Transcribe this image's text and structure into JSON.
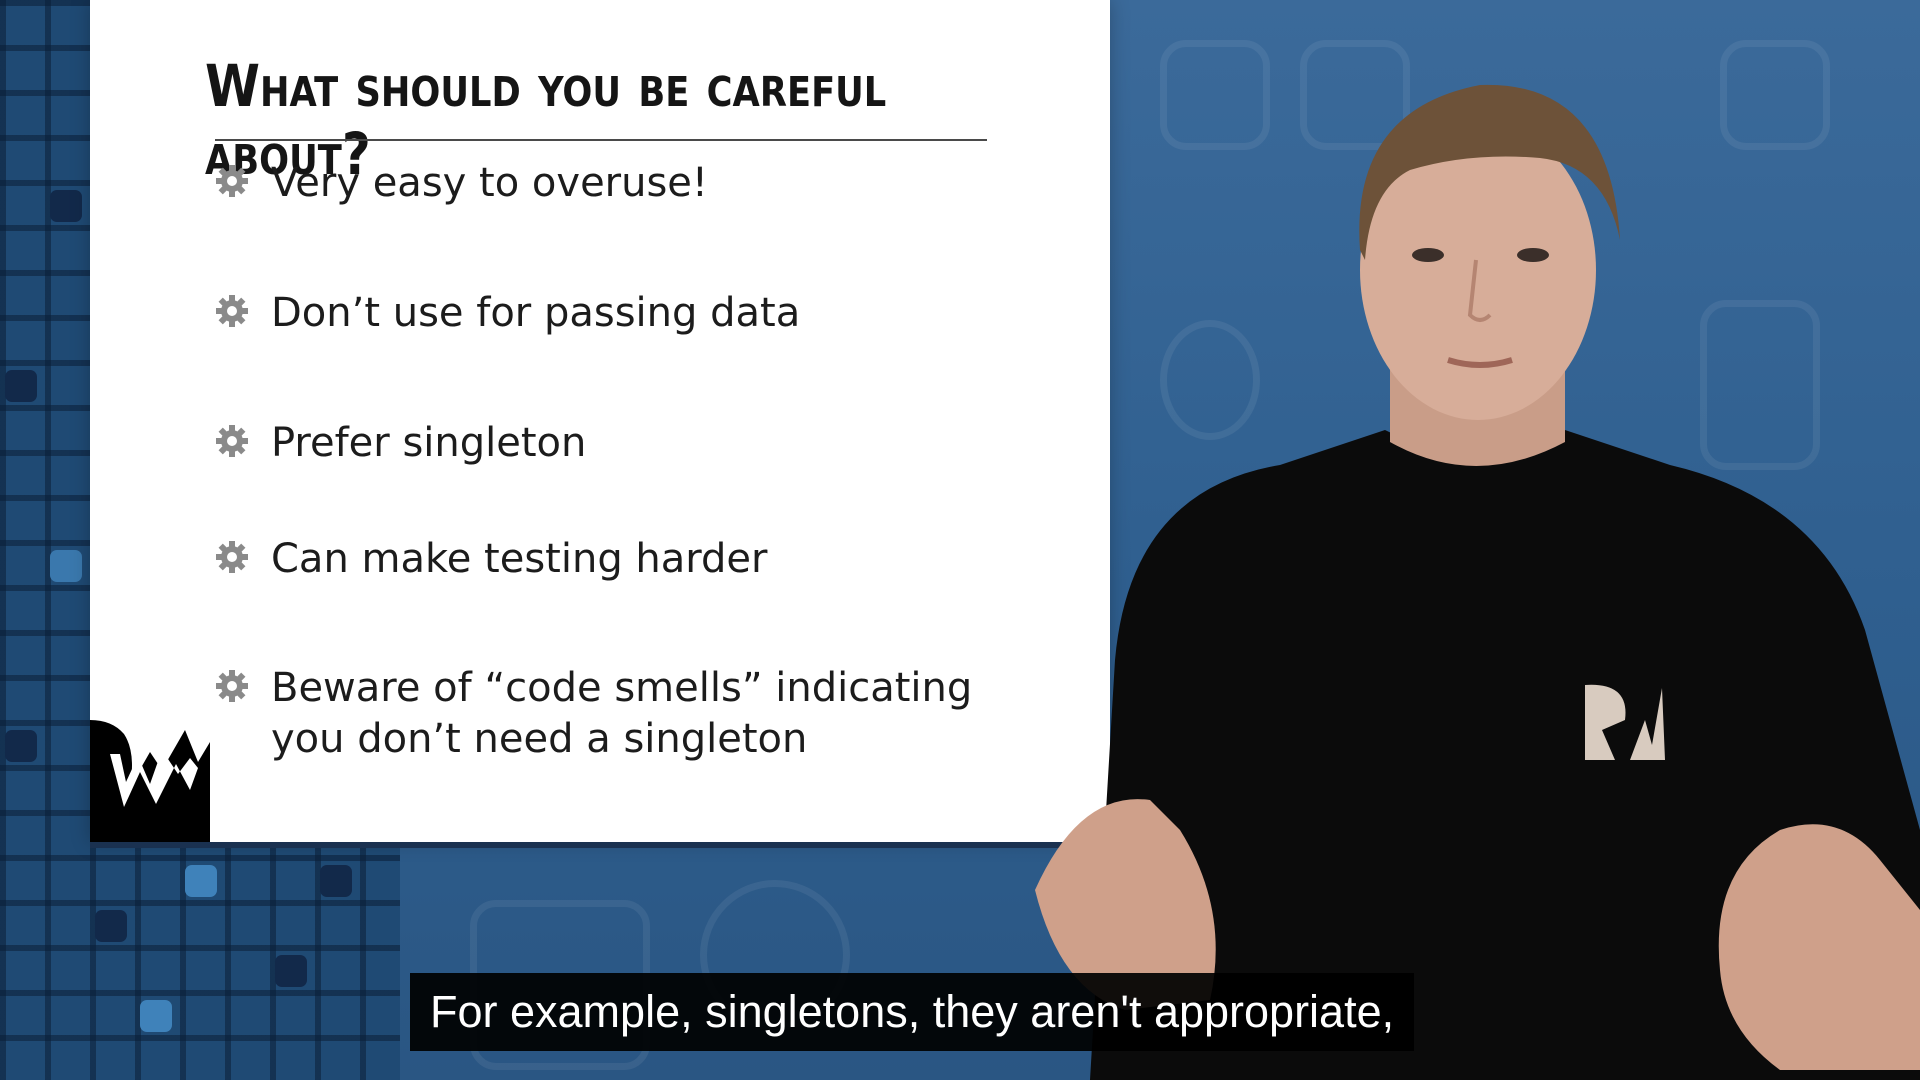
{
  "slide": {
    "title": "What should you be careful about?",
    "bullets": [
      {
        "text": "Very easy to overuse!"
      },
      {
        "text": "Don’t use for passing data"
      },
      {
        "text": "Prefer singleton"
      },
      {
        "text": "Can make testing harder"
      },
      {
        "text": "Beware of “code smells” indicating\nyou don’t need a singleton"
      }
    ],
    "bullet_icon": "gear-icon",
    "logo": "RW"
  },
  "presenter": {
    "shirt_logo": "RW"
  },
  "caption": {
    "text": "For example, singletons, they aren't appropriate,"
  },
  "colors": {
    "background": "#2f5f8f",
    "slide": "#ffffff",
    "title": "#151515",
    "bullet_icon": "#8a8a8a",
    "caption_bg": "#000000",
    "caption_text": "#ffffff"
  }
}
